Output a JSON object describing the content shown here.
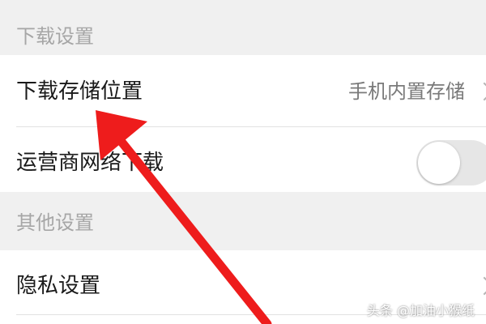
{
  "sections": {
    "download": {
      "header": "下载设置",
      "storage": {
        "label": "下载存储位置",
        "value": "手机内置存储"
      },
      "carrier": {
        "label": "运营商网络下载",
        "toggle_on": false
      }
    },
    "other": {
      "header": "其他设置",
      "privacy": {
        "label": "隐私设置"
      }
    }
  },
  "watermark": "头条 @加油小猴纸",
  "annotation": {
    "arrow_color": "#ee1c1c"
  },
  "icons": {
    "chevron": "chevron-right-icon"
  }
}
